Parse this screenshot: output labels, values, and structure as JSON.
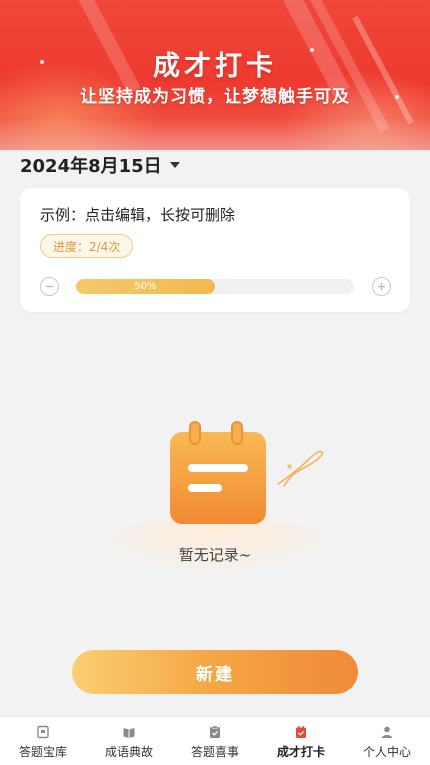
{
  "banner": {
    "title": "成才打卡",
    "subtitle": "让坚持成为习惯，让梦想触手可及"
  },
  "date_picker": {
    "value": "2024年8月15日",
    "icon": "caret-down-icon"
  },
  "task": {
    "title": "示例：点击编辑，长按可删除",
    "progress_label": "进度：2/4次",
    "percent_text": "50%",
    "progress_fraction": 0.5,
    "minus_icon": "minus-circle-icon",
    "plus_icon": "plus-circle-icon"
  },
  "empty_state": {
    "icon": "notepad-icon",
    "text": "暂无记录~"
  },
  "new_button": {
    "label": "新建"
  },
  "tabs": [
    {
      "label": "答题宝库",
      "icon": "book-icon",
      "active": false
    },
    {
      "label": "成语典故",
      "icon": "open-book-icon",
      "active": false
    },
    {
      "label": "答题喜事",
      "icon": "clipboard-icon",
      "active": false
    },
    {
      "label": "成才打卡",
      "icon": "checkin-icon",
      "active": true
    },
    {
      "label": "个人中心",
      "icon": "person-icon",
      "active": false
    }
  ],
  "colors": {
    "banner_red": "#ee3a30",
    "accent_orange": "#f5a544",
    "progress_yellow": "#f5c96a",
    "active_tab_icon": "#f0473a",
    "inactive_tab_icon": "#8a8a8a"
  }
}
